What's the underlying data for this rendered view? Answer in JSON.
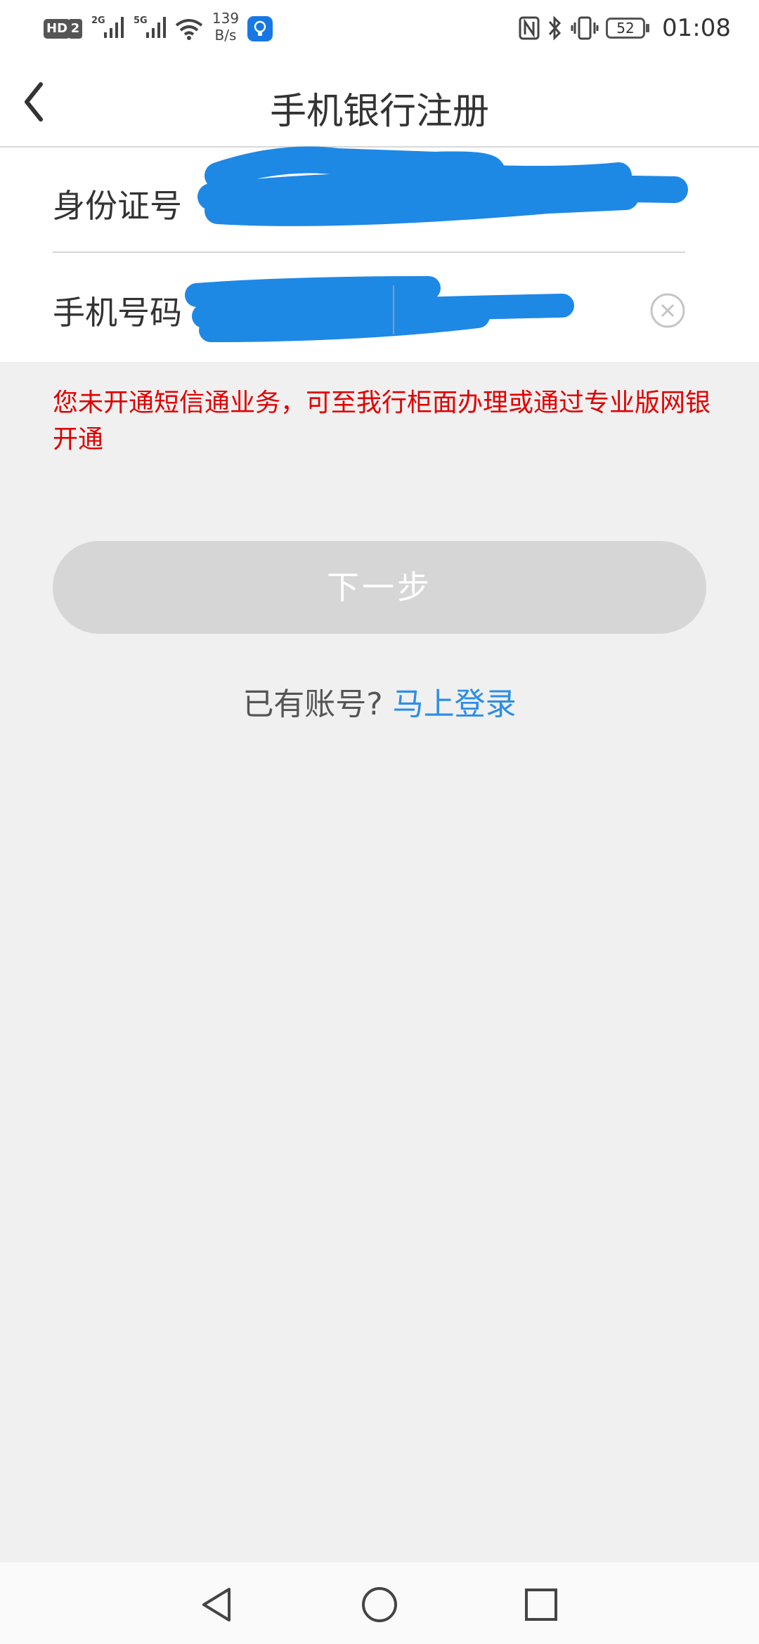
{
  "status_bar": {
    "hd_badge": "HD",
    "sim_number": "2",
    "net1": "2G",
    "net2": "5G",
    "speed_value": "139",
    "speed_unit": "B/s",
    "battery_level": "52",
    "time": "01:08"
  },
  "navbar": {
    "title": "手机银行注册"
  },
  "form": {
    "id_label": "身份证号",
    "phone_label": "手机号码"
  },
  "error_message": "您未开通短信通业务，可至我行柜面办理或通过专业版网银开通",
  "next_button": "下一步",
  "login_prompt": {
    "question": "已有账号?",
    "link": "马上登录"
  },
  "colors": {
    "error": "#e00000",
    "link": "#2c8ee8",
    "redaction": "#1e88e5",
    "button_disabled": "#d6d6d6",
    "background": "#f0f0f0"
  }
}
